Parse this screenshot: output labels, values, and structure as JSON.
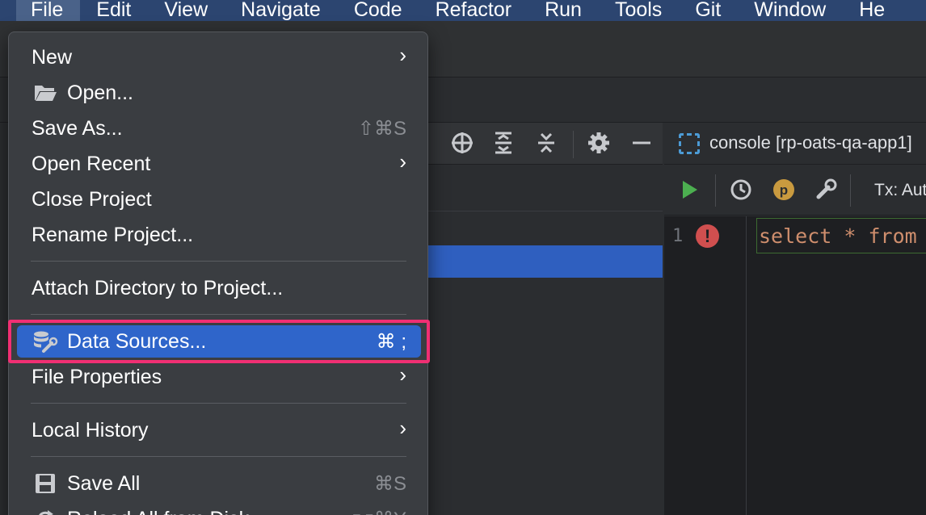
{
  "menubar": {
    "items": [
      {
        "label": "File"
      },
      {
        "label": "Edit"
      },
      {
        "label": "View"
      },
      {
        "label": "Navigate"
      },
      {
        "label": "Code"
      },
      {
        "label": "Refactor"
      },
      {
        "label": "Run"
      },
      {
        "label": "Tools"
      },
      {
        "label": "Git"
      },
      {
        "label": "Window"
      },
      {
        "label": "He"
      }
    ]
  },
  "file_menu": {
    "items": [
      {
        "label": "New",
        "submenu": true
      },
      {
        "label": "Open...",
        "icon": "folder-open-icon"
      },
      {
        "label": "Save As...",
        "shortcut": "⇧⌘S"
      },
      {
        "label": "Open Recent",
        "submenu": true
      },
      {
        "label": "Close Project"
      },
      {
        "label": "Rename Project..."
      },
      {
        "label": "Attach Directory to Project..."
      },
      {
        "label": "Data Sources...",
        "icon": "data-sources-icon",
        "shortcut": "⌘ ;",
        "selected": true
      },
      {
        "label": "File Properties",
        "submenu": true
      },
      {
        "label": "Local History",
        "submenu": true
      },
      {
        "label": "Save All",
        "icon": "save-icon",
        "shortcut": "⌘S"
      },
      {
        "label": "Reload All from Disk",
        "shortcut": "⌥⌘Y"
      }
    ],
    "chevron": "›"
  },
  "editor": {
    "tab_label": "console [rp-oats-qa-app1]",
    "tx_label": "Tx: Aut",
    "line_number": "1",
    "code_tokens": [
      "select",
      "*",
      "from"
    ]
  },
  "colors": {
    "menubar_bg": "#2c4570",
    "menu_bg": "#3a3d41",
    "selection": "#2f65ca",
    "highlight_border": "#f02f73",
    "keyword": "#cf8e6d",
    "run_green": "#4caf50",
    "error_red": "#d04f4f"
  }
}
